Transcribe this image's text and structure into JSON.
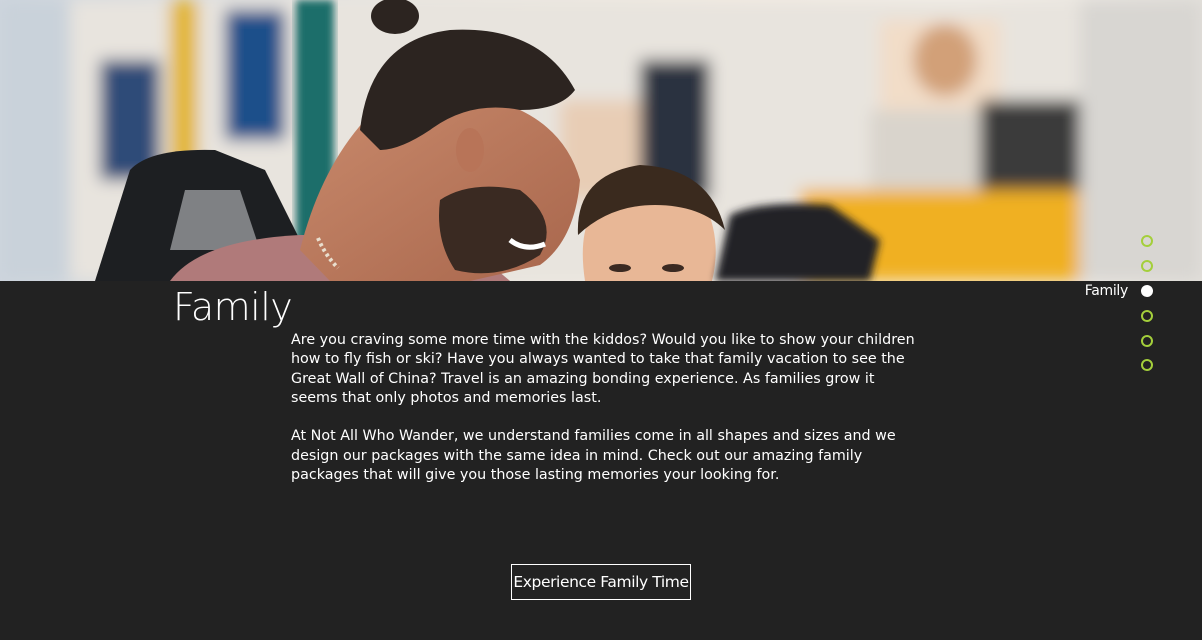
{
  "section": {
    "title": "Family",
    "paragraphs": [
      "Are you craving some more time with the kiddos? Would you like to show your children how to fly fish or ski? Have you always wanted to take that family vacation to see the Great Wall of China? Travel is an amazing bonding experience. As families grow it seems that only photos and memories last.",
      "At Not All Who Wander, we understand families come in all shapes and sizes and we design our packages with the same idea in mind. Check out our amazing family packages that will give you those lasting memories your looking for."
    ],
    "cta_label": "Experience Family Time"
  },
  "anchor_nav": {
    "items": [
      {
        "label": "",
        "active": false
      },
      {
        "label": "",
        "active": false
      },
      {
        "label": "Family",
        "active": true
      },
      {
        "label": "",
        "active": false
      },
      {
        "label": "",
        "active": false
      },
      {
        "label": "",
        "active": false
      }
    ]
  },
  "colors": {
    "background": "#222222",
    "text": "#ffffff",
    "accent": "#a4cf3b"
  },
  "icons": {
    "anchor_dot": "circle-icon"
  }
}
